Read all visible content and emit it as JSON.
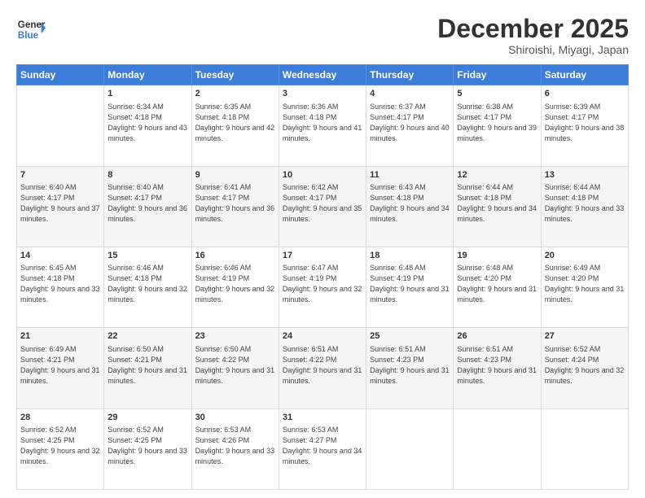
{
  "header": {
    "logo_line1": "General",
    "logo_line2": "Blue",
    "title": "December 2025",
    "subtitle": "Shiroishi, Miyagi, Japan"
  },
  "days_of_week": [
    "Sunday",
    "Monday",
    "Tuesday",
    "Wednesday",
    "Thursday",
    "Friday",
    "Saturday"
  ],
  "weeks": [
    [
      {
        "day": "",
        "sunrise": "",
        "sunset": "",
        "daylight": ""
      },
      {
        "day": "1",
        "sunrise": "Sunrise: 6:34 AM",
        "sunset": "Sunset: 4:18 PM",
        "daylight": "Daylight: 9 hours and 43 minutes."
      },
      {
        "day": "2",
        "sunrise": "Sunrise: 6:35 AM",
        "sunset": "Sunset: 4:18 PM",
        "daylight": "Daylight: 9 hours and 42 minutes."
      },
      {
        "day": "3",
        "sunrise": "Sunrise: 6:36 AM",
        "sunset": "Sunset: 4:18 PM",
        "daylight": "Daylight: 9 hours and 41 minutes."
      },
      {
        "day": "4",
        "sunrise": "Sunrise: 6:37 AM",
        "sunset": "Sunset: 4:17 PM",
        "daylight": "Daylight: 9 hours and 40 minutes."
      },
      {
        "day": "5",
        "sunrise": "Sunrise: 6:38 AM",
        "sunset": "Sunset: 4:17 PM",
        "daylight": "Daylight: 9 hours and 39 minutes."
      },
      {
        "day": "6",
        "sunrise": "Sunrise: 6:39 AM",
        "sunset": "Sunset: 4:17 PM",
        "daylight": "Daylight: 9 hours and 38 minutes."
      }
    ],
    [
      {
        "day": "7",
        "sunrise": "Sunrise: 6:40 AM",
        "sunset": "Sunset: 4:17 PM",
        "daylight": "Daylight: 9 hours and 37 minutes."
      },
      {
        "day": "8",
        "sunrise": "Sunrise: 6:40 AM",
        "sunset": "Sunset: 4:17 PM",
        "daylight": "Daylight: 9 hours and 36 minutes."
      },
      {
        "day": "9",
        "sunrise": "Sunrise: 6:41 AM",
        "sunset": "Sunset: 4:17 PM",
        "daylight": "Daylight: 9 hours and 36 minutes."
      },
      {
        "day": "10",
        "sunrise": "Sunrise: 6:42 AM",
        "sunset": "Sunset: 4:17 PM",
        "daylight": "Daylight: 9 hours and 35 minutes."
      },
      {
        "day": "11",
        "sunrise": "Sunrise: 6:43 AM",
        "sunset": "Sunset: 4:18 PM",
        "daylight": "Daylight: 9 hours and 34 minutes."
      },
      {
        "day": "12",
        "sunrise": "Sunrise: 6:44 AM",
        "sunset": "Sunset: 4:18 PM",
        "daylight": "Daylight: 9 hours and 34 minutes."
      },
      {
        "day": "13",
        "sunrise": "Sunrise: 6:44 AM",
        "sunset": "Sunset: 4:18 PM",
        "daylight": "Daylight: 9 hours and 33 minutes."
      }
    ],
    [
      {
        "day": "14",
        "sunrise": "Sunrise: 6:45 AM",
        "sunset": "Sunset: 4:18 PM",
        "daylight": "Daylight: 9 hours and 33 minutes."
      },
      {
        "day": "15",
        "sunrise": "Sunrise: 6:46 AM",
        "sunset": "Sunset: 4:18 PM",
        "daylight": "Daylight: 9 hours and 32 minutes."
      },
      {
        "day": "16",
        "sunrise": "Sunrise: 6:46 AM",
        "sunset": "Sunset: 4:19 PM",
        "daylight": "Daylight: 9 hours and 32 minutes."
      },
      {
        "day": "17",
        "sunrise": "Sunrise: 6:47 AM",
        "sunset": "Sunset: 4:19 PM",
        "daylight": "Daylight: 9 hours and 32 minutes."
      },
      {
        "day": "18",
        "sunrise": "Sunrise: 6:48 AM",
        "sunset": "Sunset: 4:19 PM",
        "daylight": "Daylight: 9 hours and 31 minutes."
      },
      {
        "day": "19",
        "sunrise": "Sunrise: 6:48 AM",
        "sunset": "Sunset: 4:20 PM",
        "daylight": "Daylight: 9 hours and 31 minutes."
      },
      {
        "day": "20",
        "sunrise": "Sunrise: 6:49 AM",
        "sunset": "Sunset: 4:20 PM",
        "daylight": "Daylight: 9 hours and 31 minutes."
      }
    ],
    [
      {
        "day": "21",
        "sunrise": "Sunrise: 6:49 AM",
        "sunset": "Sunset: 4:21 PM",
        "daylight": "Daylight: 9 hours and 31 minutes."
      },
      {
        "day": "22",
        "sunrise": "Sunrise: 6:50 AM",
        "sunset": "Sunset: 4:21 PM",
        "daylight": "Daylight: 9 hours and 31 minutes."
      },
      {
        "day": "23",
        "sunrise": "Sunrise: 6:50 AM",
        "sunset": "Sunset: 4:22 PM",
        "daylight": "Daylight: 9 hours and 31 minutes."
      },
      {
        "day": "24",
        "sunrise": "Sunrise: 6:51 AM",
        "sunset": "Sunset: 4:22 PM",
        "daylight": "Daylight: 9 hours and 31 minutes."
      },
      {
        "day": "25",
        "sunrise": "Sunrise: 6:51 AM",
        "sunset": "Sunset: 4:23 PM",
        "daylight": "Daylight: 9 hours and 31 minutes."
      },
      {
        "day": "26",
        "sunrise": "Sunrise: 6:51 AM",
        "sunset": "Sunset: 4:23 PM",
        "daylight": "Daylight: 9 hours and 31 minutes."
      },
      {
        "day": "27",
        "sunrise": "Sunrise: 6:52 AM",
        "sunset": "Sunset: 4:24 PM",
        "daylight": "Daylight: 9 hours and 32 minutes."
      }
    ],
    [
      {
        "day": "28",
        "sunrise": "Sunrise: 6:52 AM",
        "sunset": "Sunset: 4:25 PM",
        "daylight": "Daylight: 9 hours and 32 minutes."
      },
      {
        "day": "29",
        "sunrise": "Sunrise: 6:52 AM",
        "sunset": "Sunset: 4:25 PM",
        "daylight": "Daylight: 9 hours and 33 minutes."
      },
      {
        "day": "30",
        "sunrise": "Sunrise: 6:53 AM",
        "sunset": "Sunset: 4:26 PM",
        "daylight": "Daylight: 9 hours and 33 minutes."
      },
      {
        "day": "31",
        "sunrise": "Sunrise: 6:53 AM",
        "sunset": "Sunset: 4:27 PM",
        "daylight": "Daylight: 9 hours and 34 minutes."
      },
      {
        "day": "",
        "sunrise": "",
        "sunset": "",
        "daylight": ""
      },
      {
        "day": "",
        "sunrise": "",
        "sunset": "",
        "daylight": ""
      },
      {
        "day": "",
        "sunrise": "",
        "sunset": "",
        "daylight": ""
      }
    ]
  ]
}
